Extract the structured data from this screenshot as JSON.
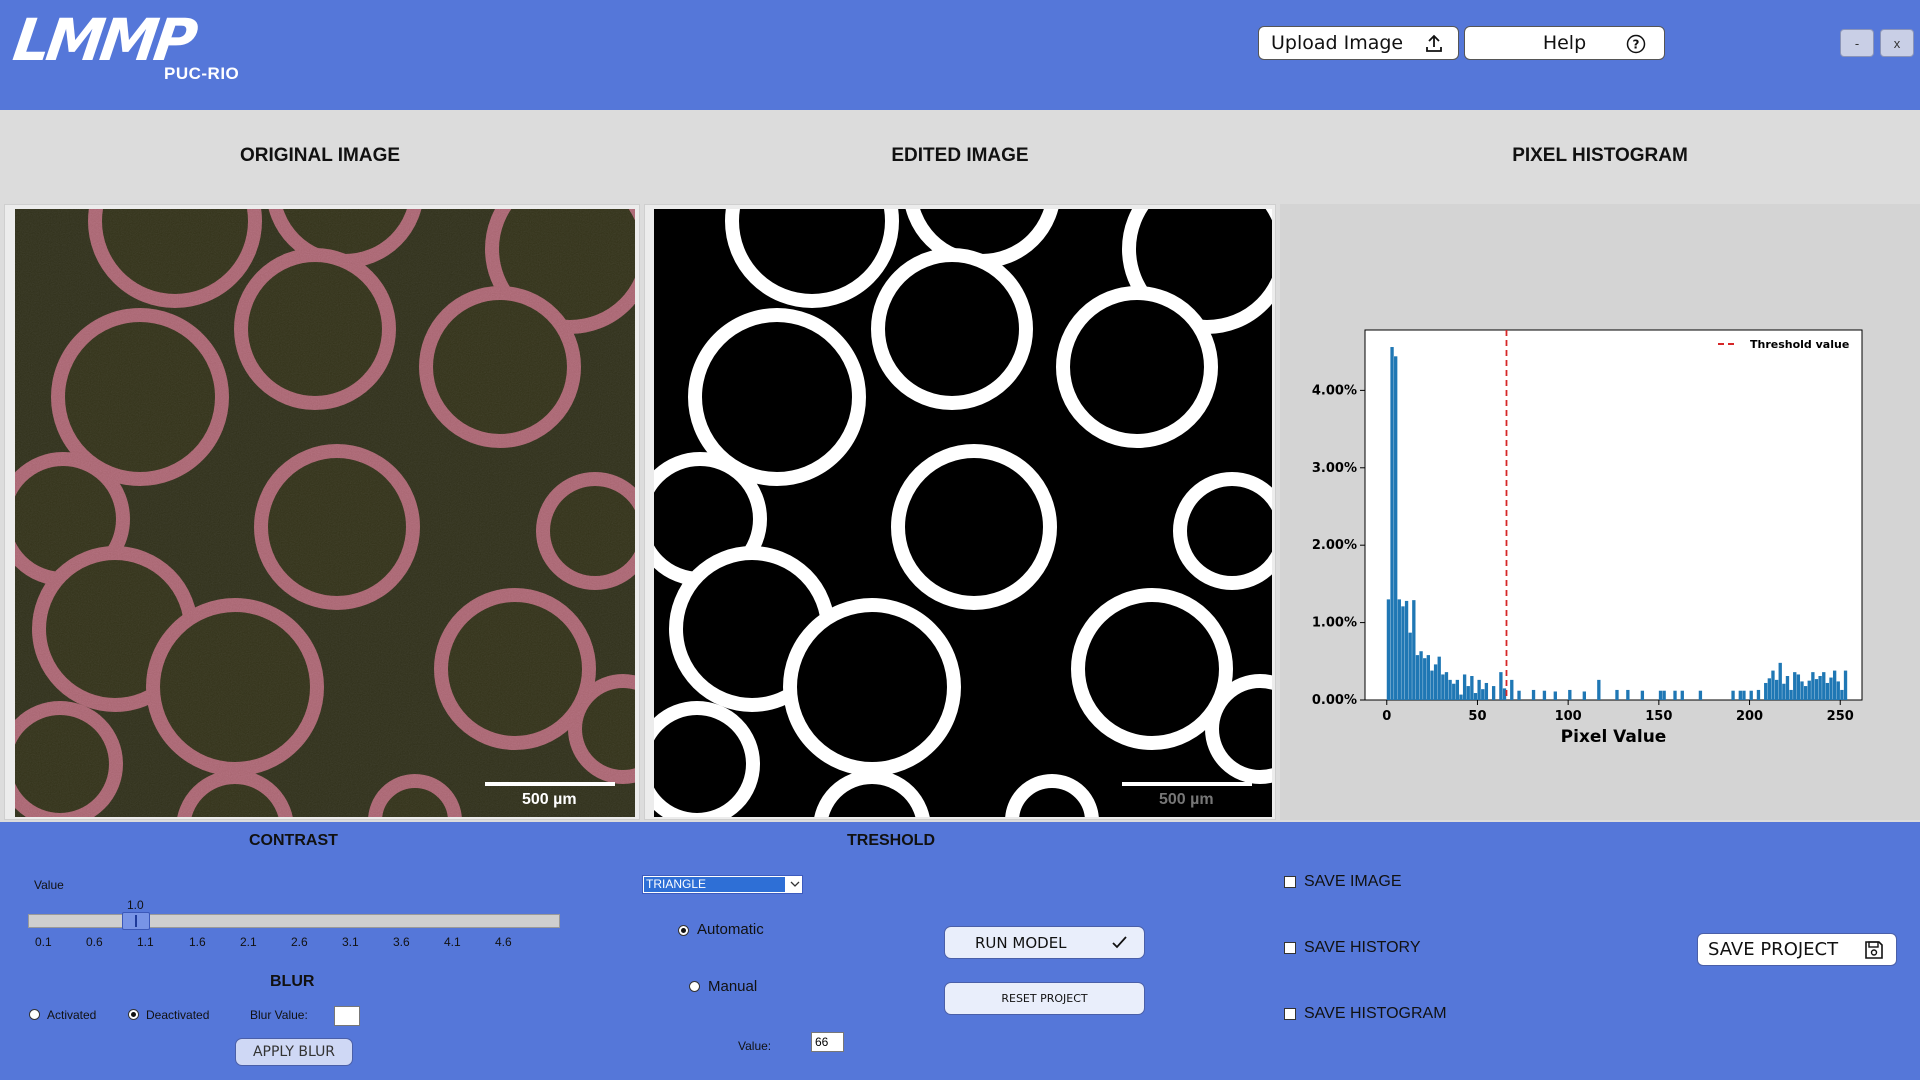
{
  "header": {
    "logo_main": "LMMP",
    "logo_sub": "PUC-RIO",
    "upload_label": "Upload Image",
    "help_label": "Help",
    "minimize_label": "-",
    "close_label": "x"
  },
  "columns": {
    "original_title": "ORIGINAL IMAGE",
    "edited_title": "EDITED IMAGE",
    "histogram_title": "PIXEL HISTOGRAM"
  },
  "images": {
    "original_scale_label": "500 µm",
    "edited_scale_label": "500 µm"
  },
  "contrast": {
    "title": "CONTRAST",
    "value_label": "Value",
    "current_value": "1.0",
    "ticks": [
      "0.1",
      "0.6",
      "1.1",
      "1.6",
      "2.1",
      "2.6",
      "3.1",
      "3.6",
      "4.1",
      "4.6"
    ]
  },
  "blur": {
    "title": "BLUR",
    "activated_label": "Activated",
    "deactivated_label": "Deactivated",
    "selected": "Deactivated",
    "blur_value_label": "Blur Value:",
    "blur_value": "",
    "apply_label": "APPLY BLUR"
  },
  "threshold": {
    "title": "TRESHOLD",
    "method": "TRIANGLE",
    "automatic_label": "Automatic",
    "manual_label": "Manual",
    "selected": "Automatic",
    "value_label": "Value:",
    "value": "66",
    "run_label": "RUN MODEL",
    "reset_label": "RESET PROJECT"
  },
  "save": {
    "save_image_label": "SAVE IMAGE",
    "save_history_label": "SAVE HISTORY",
    "save_histogram_label": "SAVE HISTOGRAM",
    "save_image_checked": false,
    "save_history_checked": false,
    "save_histogram_checked": false,
    "save_project_label": "SAVE PROJECT"
  },
  "colors": {
    "accent": "#5577d9",
    "bar": "#1f77b4",
    "threshold_line": "#d62728"
  },
  "chart_data": {
    "type": "bar",
    "xlabel": "Pixel Value",
    "ylabel": "",
    "xlim": [
      -12,
      262
    ],
    "ylim": [
      0,
      0.0478
    ],
    "xticks": [
      0,
      50,
      100,
      150,
      200,
      250
    ],
    "yticks": [
      0,
      0.01,
      0.02,
      0.03,
      0.04
    ],
    "ytick_labels": [
      "0.00%",
      "1.00%",
      "2.00%",
      "3.00%",
      "4.00%"
    ],
    "bin_width": 2,
    "threshold": 66,
    "legend": "top-right",
    "legend_label": "Threshold value",
    "bins": [
      [
        0,
        0.013
      ],
      [
        2,
        0.0456
      ],
      [
        4,
        0.0444
      ],
      [
        6,
        0.013
      ],
      [
        8,
        0.0121
      ],
      [
        10,
        0.0128
      ],
      [
        12,
        0.0087
      ],
      [
        14,
        0.0129
      ],
      [
        16,
        0.0058
      ],
      [
        18,
        0.0063
      ],
      [
        20,
        0.0054
      ],
      [
        22,
        0.0058
      ],
      [
        24,
        0.0038
      ],
      [
        26,
        0.0046
      ],
      [
        28,
        0.0056
      ],
      [
        30,
        0.0033
      ],
      [
        32,
        0.0036
      ],
      [
        34,
        0.0026
      ],
      [
        36,
        0.0021
      ],
      [
        38,
        0.0026
      ],
      [
        40,
        0.0007
      ],
      [
        42,
        0.0033
      ],
      [
        44,
        0.0018
      ],
      [
        46,
        0.0031
      ],
      [
        48,
        0.0009
      ],
      [
        50,
        0.0026
      ],
      [
        52,
        0.0014
      ],
      [
        54,
        0.0022
      ],
      [
        58,
        0.0018
      ],
      [
        62,
        0.0036
      ],
      [
        64,
        0.0015
      ],
      [
        68,
        0.0026
      ],
      [
        72,
        0.0012
      ],
      [
        80,
        0.0013
      ],
      [
        86,
        0.0012
      ],
      [
        92,
        0.0011
      ],
      [
        100,
        0.0013
      ],
      [
        108,
        0.0011
      ],
      [
        116,
        0.0026
      ],
      [
        126,
        0.0013
      ],
      [
        132,
        0.0013
      ],
      [
        140,
        0.0012
      ],
      [
        150,
        0.0012
      ],
      [
        152,
        0.0012
      ],
      [
        158,
        0.0012
      ],
      [
        162,
        0.0012
      ],
      [
        172,
        0.0012
      ],
      [
        190,
        0.0012
      ],
      [
        194,
        0.0012
      ],
      [
        196,
        0.0012
      ],
      [
        200,
        0.0012
      ],
      [
        204,
        0.0013
      ],
      [
        208,
        0.0022
      ],
      [
        210,
        0.0028
      ],
      [
        212,
        0.0038
      ],
      [
        214,
        0.0026
      ],
      [
        216,
        0.0048
      ],
      [
        218,
        0.0021
      ],
      [
        220,
        0.0031
      ],
      [
        222,
        0.0013
      ],
      [
        224,
        0.0036
      ],
      [
        226,
        0.0033
      ],
      [
        228,
        0.0024
      ],
      [
        230,
        0.0018
      ],
      [
        232,
        0.0025
      ],
      [
        234,
        0.0036
      ],
      [
        236,
        0.0027
      ],
      [
        238,
        0.0031
      ],
      [
        240,
        0.0036
      ],
      [
        242,
        0.0022
      ],
      [
        244,
        0.0029
      ],
      [
        246,
        0.0038
      ],
      [
        248,
        0.0024
      ],
      [
        250,
        0.0013
      ],
      [
        252,
        0.0038
      ]
    ]
  }
}
